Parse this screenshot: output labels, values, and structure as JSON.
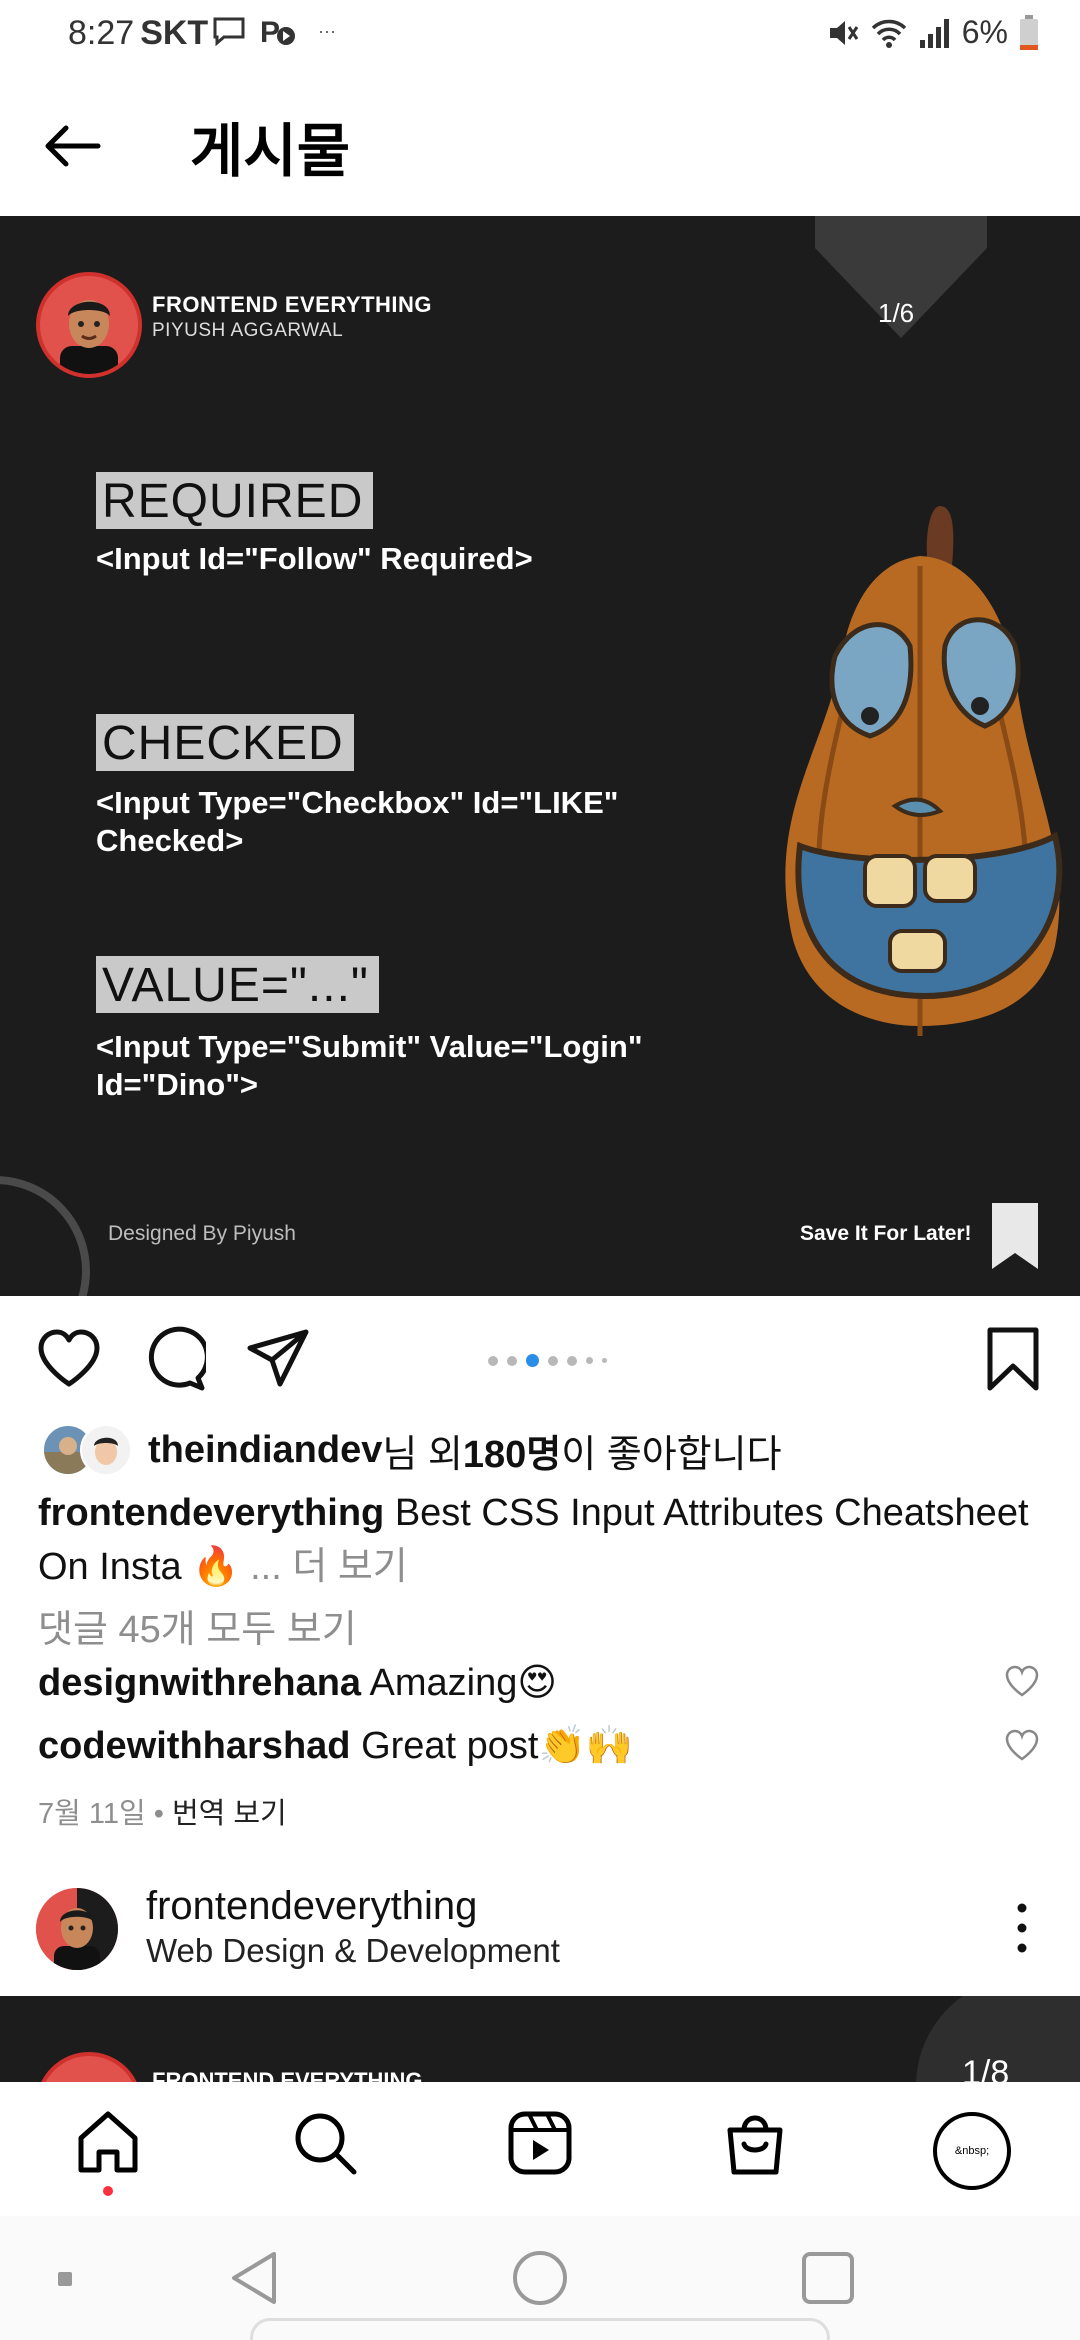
{
  "status_bar": {
    "time": "8:27",
    "carrier": "SKT",
    "overflow": "···",
    "battery": "6%",
    "icons": [
      "message-icon",
      "p-badge-icon",
      "mute-icon",
      "wifi-icon",
      "signal-icon",
      "battery-icon"
    ]
  },
  "header": {
    "title": "게시물",
    "back_icon": "back-arrow-icon"
  },
  "post": {
    "brand_title": "FRONTEND EVERYTHING",
    "brand_subtitle": "PIYUSH AGGARWAL",
    "counter": "1/6",
    "items": [
      {
        "label": "REQUIRED",
        "code": "<Input Id=\"Follow\" Required>"
      },
      {
        "label": "CHECKED",
        "code": "<Input Type=\"Checkbox\" Id=\"LIKE\" Checked>"
      },
      {
        "label": "VALUE=\"...\"",
        "code": "<Input Type=\"Submit\" Value=\"Login\" Id=\"Dino\">"
      }
    ],
    "designed_by": "Designed By Piyush",
    "save_later": "Save It For Later!"
  },
  "actions": {
    "icons": [
      "heart-icon",
      "comment-icon",
      "share-icon",
      "bookmark-icon"
    ],
    "carousel_total": 7,
    "carousel_active_index": 2
  },
  "likes": {
    "first_liker": "theindiandev",
    "mid": "님 외 ",
    "count": "180명",
    "tail": "이 좋아합니다"
  },
  "caption": {
    "username": "frontendeverything",
    "text": "Best CSS Input Attributes Cheatsheet On Insta",
    "emoji": "🔥",
    "more": "... 더 보기"
  },
  "comments": {
    "view_all": "댓글 45개 모두 보기",
    "items": [
      {
        "user": "designwithrehana",
        "text": "Amazing😍"
      },
      {
        "user": "codewithharshad",
        "text": "Great post👏🙌"
      }
    ]
  },
  "meta": {
    "date": "7월 11일",
    "separator": " • ",
    "translate": "번역 보기"
  },
  "suggested": {
    "name": "frontendeverything",
    "description": "Web Design & Development"
  },
  "next_post": {
    "counter": "1/8",
    "brand_title": "FRONTEND EVERYTHING"
  },
  "bottom_nav": {
    "items": [
      "home-icon",
      "search-icon",
      "reels-icon",
      "shop-icon",
      "profile-icon"
    ],
    "profile_text": "&nbsp;"
  },
  "colors": {
    "accent_blue": "#2a8de8",
    "post_bg": "#1c1c1c",
    "brand_red": "#d0312d",
    "notification": "#ff3040"
  }
}
